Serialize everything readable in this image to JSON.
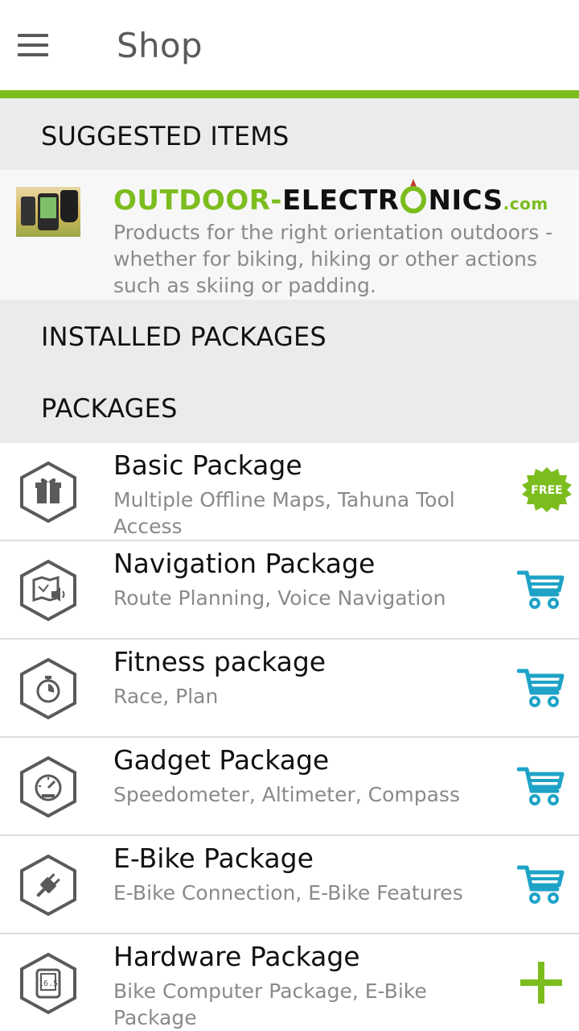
{
  "appbar": {
    "title": "Shop",
    "menu_icon": "hamburger-menu-icon"
  },
  "colors": {
    "accent": "#7cbd1e",
    "cart": "#1ea3c7",
    "icon_gray": "#5a5a5a",
    "section_bg": "#ebebeb"
  },
  "sections": {
    "suggested": "SUGGESTED ITEMS",
    "installed": "INSTALLED PACKAGES",
    "packages": "PACKAGES"
  },
  "banner": {
    "logo_part1": "OUTDOOR-",
    "logo_part2": "ELECTR",
    "logo_part3": "NICS",
    "logo_suffix": ".com",
    "description": "Products for the right orientation outdoors - whether for biking, hiking or other actions such as skiing or padding."
  },
  "packages": [
    {
      "name": "Basic Package",
      "desc": "Multiple Offline Maps, Tahuna Tool Access",
      "icon": "gift-icon",
      "action": "free-badge",
      "badge": "FREE"
    },
    {
      "name": "Navigation Package",
      "desc": "Route Planning, Voice Navigation",
      "icon": "map-voice-icon",
      "action": "cart"
    },
    {
      "name": "Fitness package",
      "desc": "Race, Plan",
      "icon": "stopwatch-icon",
      "action": "cart"
    },
    {
      "name": "Gadget Package",
      "desc": "Speedometer, Altimeter, Compass",
      "icon": "speedometer-icon",
      "action": "cart"
    },
    {
      "name": "E-Bike Package",
      "desc": "E-Bike Connection, E-Bike Features",
      "icon": "plug-icon",
      "action": "cart"
    },
    {
      "name": "Hardware Package",
      "desc": "Bike Computer Package, E-Bike Package",
      "icon": "bike-computer-icon",
      "action": "add"
    }
  ]
}
